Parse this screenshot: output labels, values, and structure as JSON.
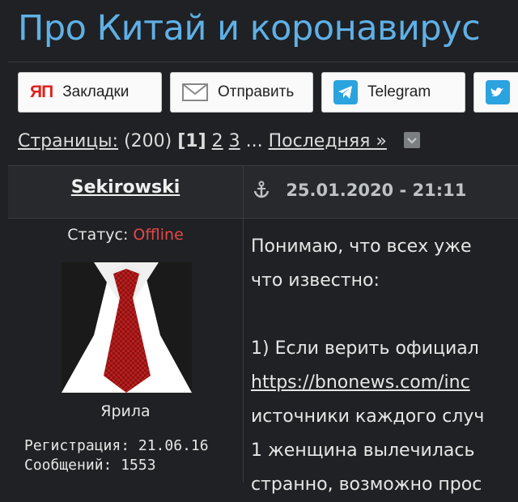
{
  "topic": {
    "title": "Про Китай и коронавирус"
  },
  "share": {
    "bookmarks_label": "Закладки",
    "bookmarks_icon_text": "ЯП",
    "send_label": "Отправить",
    "telegram_label": "Telegram"
  },
  "pagination": {
    "label": "Страницы:",
    "total": "(200)",
    "current": "[1]",
    "pages": [
      "2",
      "3"
    ],
    "ellipsis": "...",
    "last_label": "Последняя »"
  },
  "post": {
    "author": "Sekirowski",
    "date": "25.01.2020 - 21:11",
    "status_label": "Статус:",
    "status_value": "Offline",
    "nickname": "Ярила",
    "registration": "Регистрация: 21.06.16",
    "messages": "Сообщений: 1553",
    "lines": [
      "Понимаю, что всех уже",
      "что известно:",
      "1) Если верить официал",
      "https://bnonews.com/inc",
      "источники каждого случ",
      "1 женщина вылечилась",
      "странно, возможно прос"
    ]
  },
  "colors": {
    "title": "#5fb0e6",
    "offline": "#e54848",
    "background": "#1f2124",
    "telegram": "#2aa3df"
  }
}
